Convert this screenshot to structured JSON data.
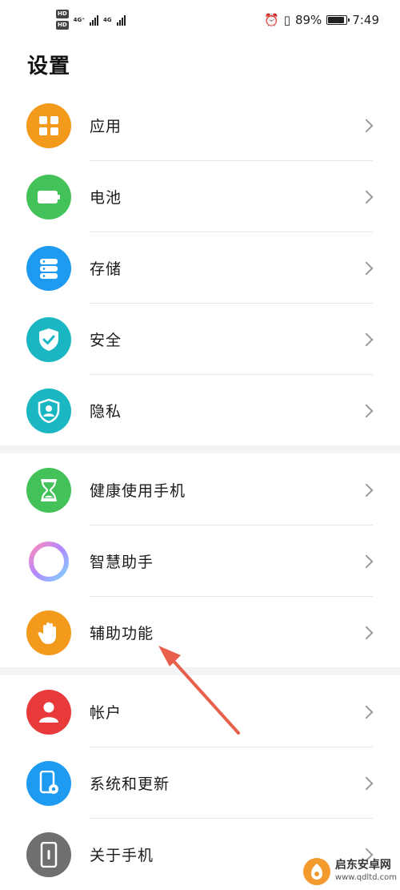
{
  "status_bar": {
    "hd_badges": [
      "HD",
      "HD"
    ],
    "network_labels": [
      "4G⁺",
      "4G"
    ],
    "battery_percent_text": "89%",
    "battery_level": 0.89,
    "time": "7:49",
    "alarm_icon": "⏰",
    "vibrate_icon": "▯"
  },
  "page": {
    "title": "设置"
  },
  "groups": [
    {
      "items": [
        {
          "label": "应用",
          "icon": "apps-icon",
          "color": "#f39a1d"
        },
        {
          "label": "电池",
          "icon": "battery-icon",
          "color": "#43c25a"
        },
        {
          "label": "存储",
          "icon": "storage-icon",
          "color": "#1e9bf0"
        },
        {
          "label": "安全",
          "icon": "shield-check-icon",
          "color": "#1ab7c3"
        },
        {
          "label": "隐私",
          "icon": "privacy-icon",
          "color": "#1ab7c3"
        }
      ]
    },
    {
      "items": [
        {
          "label": "健康使用手机",
          "icon": "hourglass-icon",
          "color": "#43c25a"
        },
        {
          "label": "智慧助手",
          "icon": "assistant-ring-icon",
          "color": "#ffffff"
        },
        {
          "label": "辅助功能",
          "icon": "hand-icon",
          "color": "#f39a1d"
        }
      ]
    },
    {
      "items": [
        {
          "label": "帐户",
          "icon": "account-icon",
          "color": "#e83a3a"
        },
        {
          "label": "系统和更新",
          "icon": "system-update-icon",
          "color": "#1e9bf0"
        },
        {
          "label": "关于手机",
          "icon": "phone-info-icon",
          "color": "#6f6f6f"
        }
      ]
    }
  ],
  "watermark": {
    "name": "启东安卓网",
    "url": "www.qdltd.com"
  },
  "annotation": {
    "color": "#e8604c"
  }
}
